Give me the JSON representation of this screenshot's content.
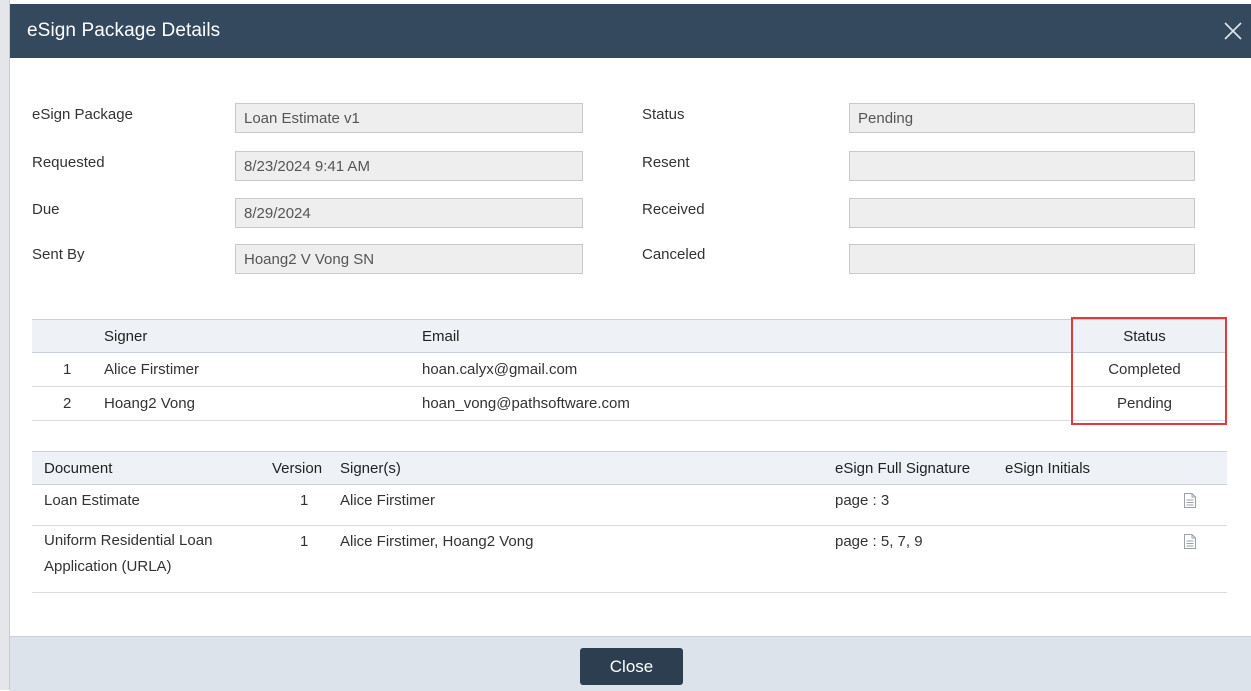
{
  "dialog": {
    "title": "eSign Package Details",
    "close_icon": "close-icon"
  },
  "form": {
    "package_label": "eSign Package",
    "package_value": "Loan Estimate v1",
    "requested_label": "Requested",
    "requested_value": "8/23/2024 9:41 AM",
    "due_label": "Due",
    "due_value": "8/29/2024",
    "sent_by_label": "Sent By",
    "sent_by_value": "Hoang2 V Vong SN",
    "status_label": "Status",
    "status_value": "Pending",
    "resent_label": "Resent",
    "resent_value": "",
    "received_label": "Received",
    "received_value": "",
    "canceled_label": "Canceled",
    "canceled_value": ""
  },
  "signers": {
    "headers": {
      "signer": "Signer",
      "email": "Email",
      "status": "Status"
    },
    "rows": [
      {
        "num": "1",
        "name": "Alice Firstimer",
        "email": "hoan.calyx@gmail.com",
        "status": "Completed"
      },
      {
        "num": "2",
        "name": "Hoang2 Vong",
        "email": "hoan_vong@pathsoftware.com",
        "status": "Pending"
      }
    ]
  },
  "documents": {
    "headers": {
      "document": "Document",
      "version": "Version",
      "signers": "Signer(s)",
      "full_signature": "eSign Full Signature",
      "initials": "eSign Initials"
    },
    "rows": [
      {
        "document": "Loan Estimate",
        "version": "1",
        "signers": "Alice Firstimer",
        "full_signature": "page : 3",
        "initials": "",
        "icon": "document-icon"
      },
      {
        "document_line1": "Uniform Residential Loan",
        "document_line2": "Application (URLA)",
        "version": "1",
        "signers": "Alice Firstimer, Hoang2 Vong",
        "full_signature": "page : 5, 7, 9",
        "initials": "",
        "icon": "document-icon"
      }
    ]
  },
  "footer": {
    "close_label": "Close"
  },
  "colors": {
    "titlebar": "#34495e",
    "highlight": "#e03a3a",
    "button": "#2c3e50",
    "footer": "#dde3ea"
  }
}
